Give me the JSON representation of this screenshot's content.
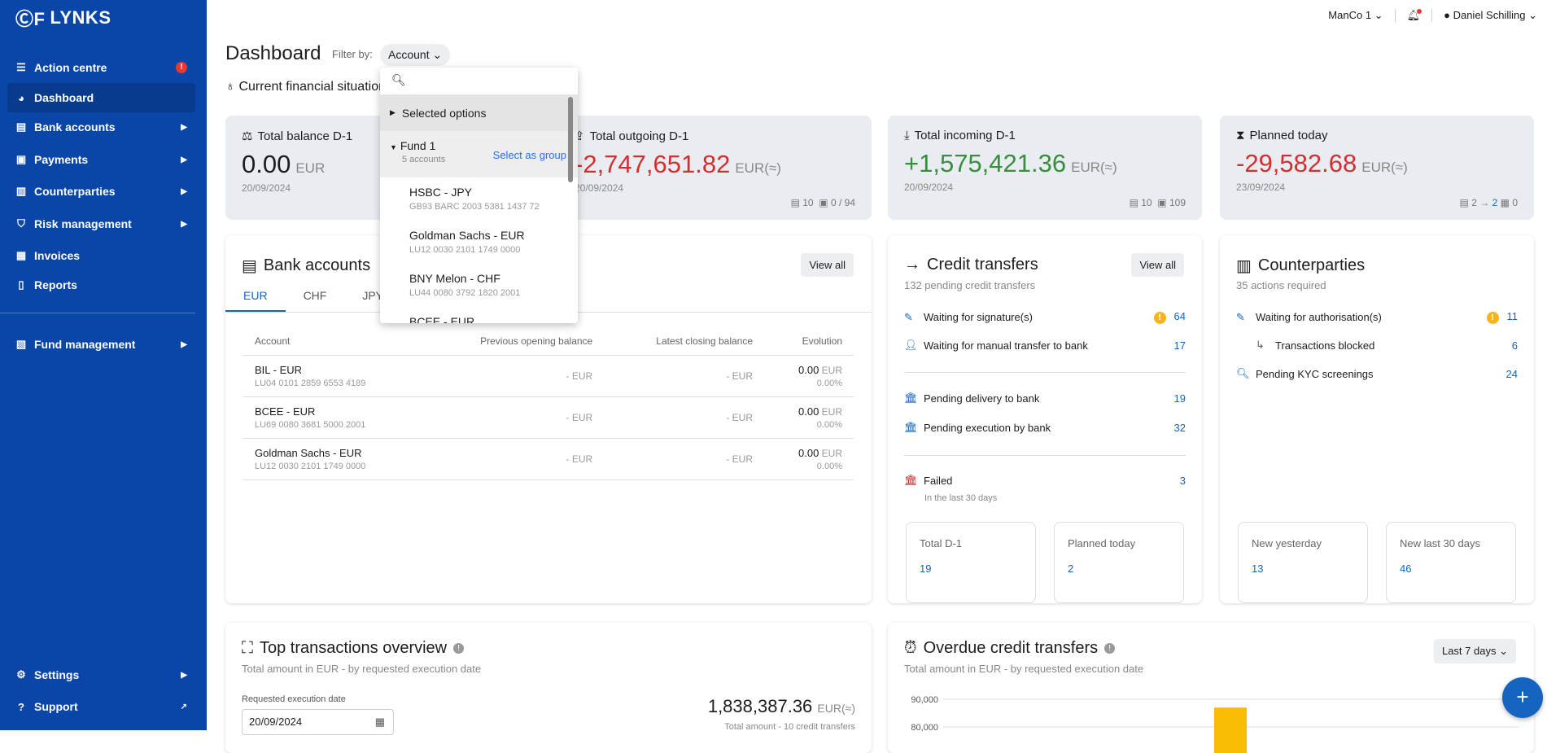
{
  "brand": "LYNKS",
  "sidebar": {
    "items": [
      {
        "label": "Action centre",
        "icon": "checklist-icon",
        "badge": "!"
      },
      {
        "label": "Dashboard",
        "icon": "dashboard-icon",
        "active": true
      },
      {
        "label": "Bank accounts",
        "icon": "bank-card-icon"
      },
      {
        "label": "Payments",
        "icon": "payments-icon"
      },
      {
        "label": "Counterparties",
        "icon": "building-icon"
      },
      {
        "label": "Risk management",
        "icon": "shield-icon"
      },
      {
        "label": "Invoices",
        "icon": "invoice-icon"
      },
      {
        "label": "Reports",
        "icon": "report-icon"
      },
      {
        "label": "Fund management",
        "icon": "fund-icon"
      },
      {
        "label": "Settings",
        "icon": "gear-icon"
      },
      {
        "label": "Support",
        "icon": "support-icon"
      }
    ]
  },
  "topbar": {
    "entity": "ManCo 1",
    "user": "Daniel Schilling"
  },
  "header": {
    "title": "Dashboard",
    "filter_label": "Filter by:",
    "filter_value": "Account",
    "section": "Current financial situation"
  },
  "dropdown": {
    "selected_options": "Selected options",
    "group": {
      "name": "Fund 1",
      "count": "5 accounts",
      "action": "Select as group"
    },
    "items": [
      {
        "name": "HSBC - JPY",
        "iban": "GB93 BARC 2003 5381 1437 72"
      },
      {
        "name": "Goldman Sachs - EUR",
        "iban": "LU12 0030 2101 1749 0000"
      },
      {
        "name": "BNY Melon - CHF",
        "iban": "LU44 0080 3792 1820 2001"
      },
      {
        "name": "BCEE - EUR",
        "iban": ""
      }
    ]
  },
  "stats": [
    {
      "title": "Total balance D-1",
      "value": "0.00",
      "currency": "EUR",
      "date": "20/09/2024"
    },
    {
      "title": "Total outgoing D-1",
      "value": "-2,747,651.82",
      "currency": "EUR(≈)",
      "date": "20/09/2024",
      "foot1": "10",
      "foot2": "0 / 94"
    },
    {
      "title": "Total incoming D-1",
      "value": "+1,575,421.36",
      "currency": "EUR(≈)",
      "date": "20/09/2024",
      "foot1": "10",
      "foot2": "109"
    },
    {
      "title": "Planned today",
      "value": "-29,582.68",
      "currency": "EUR(≈)",
      "date": "23/09/2024",
      "foot1": "2",
      "foot2": "2",
      "foot3": "0"
    }
  ],
  "bank_accounts": {
    "title": "Bank accounts",
    "view_all": "View all",
    "tabs": [
      "EUR",
      "CHF",
      "JPY"
    ],
    "columns": [
      "Account",
      "Previous opening balance",
      "Latest closing balance",
      "Evolution"
    ],
    "rows": [
      {
        "name": "BIL - EUR",
        "iban": "LU04 0101 2859 6553 4189",
        "prev": "- EUR",
        "latest": "- EUR",
        "evo": "0.00",
        "evo_cur": "EUR",
        "evo_pct": "0.00%"
      },
      {
        "name": "BCEE - EUR",
        "iban": "LU69 0080 3681 5000 2001",
        "prev": "- EUR",
        "latest": "- EUR",
        "evo": "0.00",
        "evo_cur": "EUR",
        "evo_pct": "0.00%"
      },
      {
        "name": "Goldman Sachs - EUR",
        "iban": "LU12 0030 2101 1749 0000",
        "prev": "- EUR",
        "latest": "- EUR",
        "evo": "0.00",
        "evo_cur": "EUR",
        "evo_pct": "0.00%"
      }
    ]
  },
  "credit_transfers": {
    "title": "Credit transfers",
    "subtitle": "132 pending credit transfers",
    "view_all": "View all",
    "items": [
      {
        "label": "Waiting for signature(s)",
        "count": "64"
      },
      {
        "label": "Waiting for manual transfer to bank",
        "count": "17"
      },
      {
        "label": "Pending delivery to bank",
        "count": "19"
      },
      {
        "label": "Pending execution by bank",
        "count": "32"
      },
      {
        "label": "Failed",
        "count": "3",
        "note": "In the last 30 days"
      }
    ],
    "total_label": "Total D-1",
    "total": "19",
    "planned_label": "Planned today",
    "planned": "2"
  },
  "counterparties": {
    "title": "Counterparties",
    "subtitle": "35 actions required",
    "items": [
      {
        "label": "Waiting for authorisation(s)",
        "count": "11"
      },
      {
        "label": "Transactions blocked",
        "count": "6"
      },
      {
        "label": "Pending KYC screenings",
        "count": "24"
      }
    ],
    "new_yesterday_label": "New yesterday",
    "new_yesterday": "13",
    "new_30_label": "New last 30 days",
    "new_30": "46"
  },
  "top_transactions": {
    "title": "Top transactions overview",
    "subtitle": "Total amount in EUR - by requested execution date",
    "date_label": "Requested execution date",
    "date": "20/09/2024",
    "total": "1,838,387.36",
    "currency": "EUR(≈)",
    "total_note": "Total amount - 10 credit transfers"
  },
  "overdue": {
    "title": "Overdue credit transfers",
    "subtitle": "Total amount in EUR - by requested execution date",
    "period": "Last 7 days"
  },
  "chart_data": {
    "type": "bar",
    "yticks": [
      "90,000",
      "80,000"
    ],
    "values": [
      87000
    ],
    "color": "#fbbc05",
    "grid": true
  },
  "fab": "+"
}
